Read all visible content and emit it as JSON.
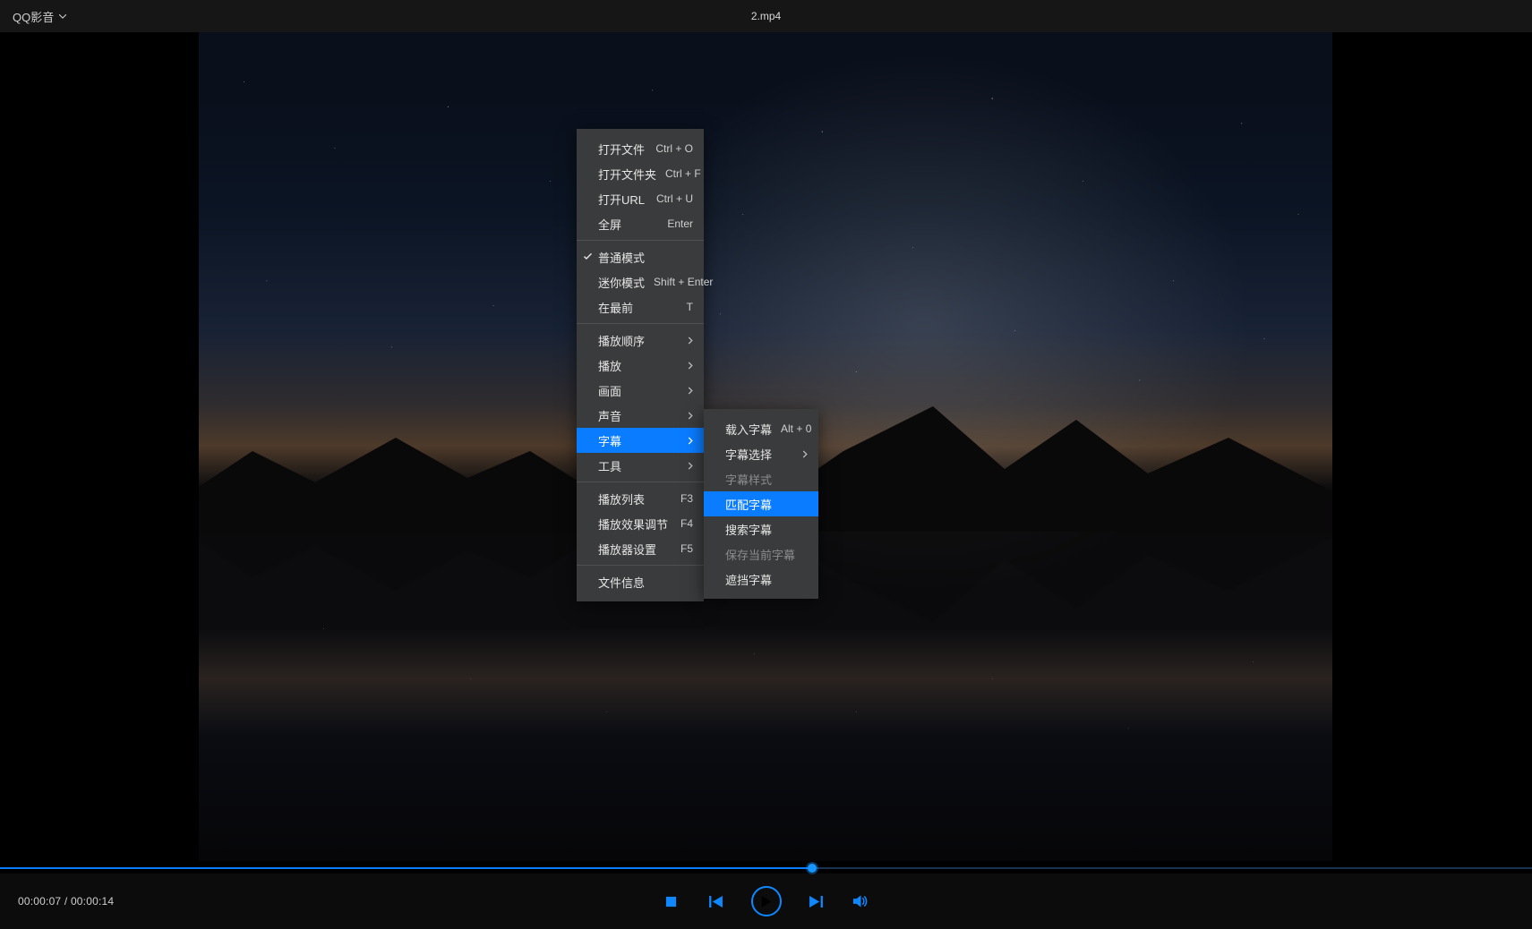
{
  "app": {
    "name": "QQ影音"
  },
  "header": {
    "file": "2.mp4"
  },
  "playback": {
    "current": "00:00:07",
    "duration": "00:00:14",
    "progress_ratio": 0.53
  },
  "context_menu": {
    "items": [
      {
        "label": "打开文件",
        "shortcut": "Ctrl + O"
      },
      {
        "label": "打开文件夹",
        "shortcut": "Ctrl + F"
      },
      {
        "label": "打开URL",
        "shortcut": "Ctrl + U"
      },
      {
        "label": "全屏",
        "shortcut": "Enter"
      },
      {
        "sep": true
      },
      {
        "label": "普通模式",
        "checked": true
      },
      {
        "label": "迷你模式",
        "shortcut": "Shift + Enter"
      },
      {
        "label": "在最前",
        "shortcut": "T"
      },
      {
        "sep": true
      },
      {
        "label": "播放顺序",
        "submenu": true
      },
      {
        "label": "播放",
        "submenu": true
      },
      {
        "label": "画面",
        "submenu": true
      },
      {
        "label": "声音",
        "submenu": true
      },
      {
        "label": "字幕",
        "submenu": true,
        "selected": true
      },
      {
        "label": "工具",
        "submenu": true
      },
      {
        "sep": true
      },
      {
        "label": "播放列表",
        "shortcut": "F3"
      },
      {
        "label": "播放效果调节",
        "shortcut": "F4"
      },
      {
        "label": "播放器设置",
        "shortcut": "F5"
      },
      {
        "sep": true
      },
      {
        "label": "文件信息"
      }
    ]
  },
  "subtitle_submenu": {
    "items": [
      {
        "label": "载入字幕",
        "shortcut": "Alt + 0"
      },
      {
        "label": "字幕选择",
        "submenu": true
      },
      {
        "label": "字幕样式",
        "disabled": true
      },
      {
        "label": "匹配字幕",
        "selected": true
      },
      {
        "label": "搜索字幕"
      },
      {
        "label": "保存当前字幕",
        "disabled": true
      },
      {
        "label": "遮挡字幕"
      }
    ]
  }
}
